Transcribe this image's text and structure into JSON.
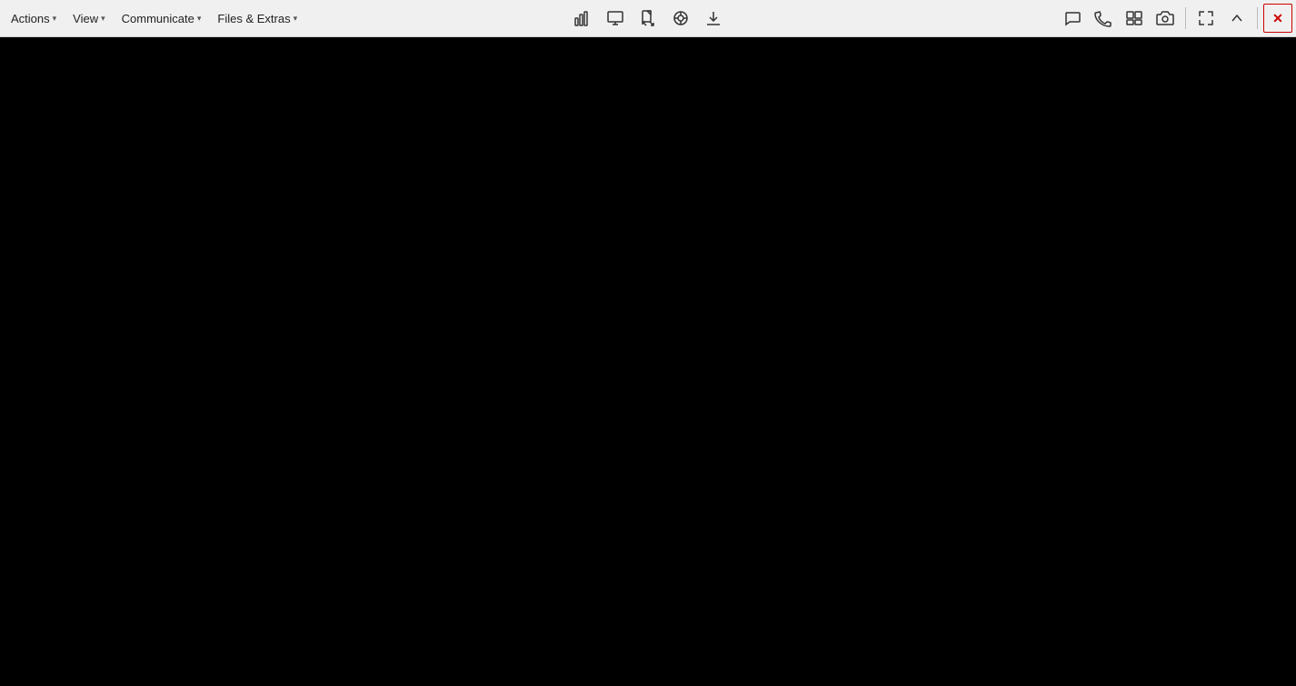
{
  "toolbar": {
    "menus": [
      {
        "id": "actions",
        "label": "Actions",
        "has_chevron": true
      },
      {
        "id": "view",
        "label": "View",
        "has_chevron": true
      },
      {
        "id": "communicate",
        "label": "Communicate",
        "has_chevron": true
      },
      {
        "id": "files-extras",
        "label": "Files & Extras",
        "has_chevron": true
      }
    ],
    "center_icons": [
      {
        "id": "stats",
        "title": "Statistics"
      },
      {
        "id": "screen",
        "title": "Screen"
      },
      {
        "id": "file-transfer",
        "title": "File Transfer"
      },
      {
        "id": "radial",
        "title": "Radial Menu"
      },
      {
        "id": "download",
        "title": "Download"
      }
    ],
    "right_icons": [
      {
        "id": "chat",
        "title": "Chat"
      },
      {
        "id": "phone",
        "title": "Phone"
      },
      {
        "id": "view-toggle",
        "title": "View Toggle"
      },
      {
        "id": "camera",
        "title": "Camera/Screenshot"
      }
    ],
    "window_controls": [
      {
        "id": "fullscreen",
        "title": "Fullscreen"
      },
      {
        "id": "minimize",
        "title": "Minimize"
      },
      {
        "id": "close",
        "title": "Close"
      }
    ],
    "close_label": "✕",
    "minimize_label": "▲",
    "fullscreen_label": "⛶"
  },
  "main": {
    "background": "#000000"
  }
}
